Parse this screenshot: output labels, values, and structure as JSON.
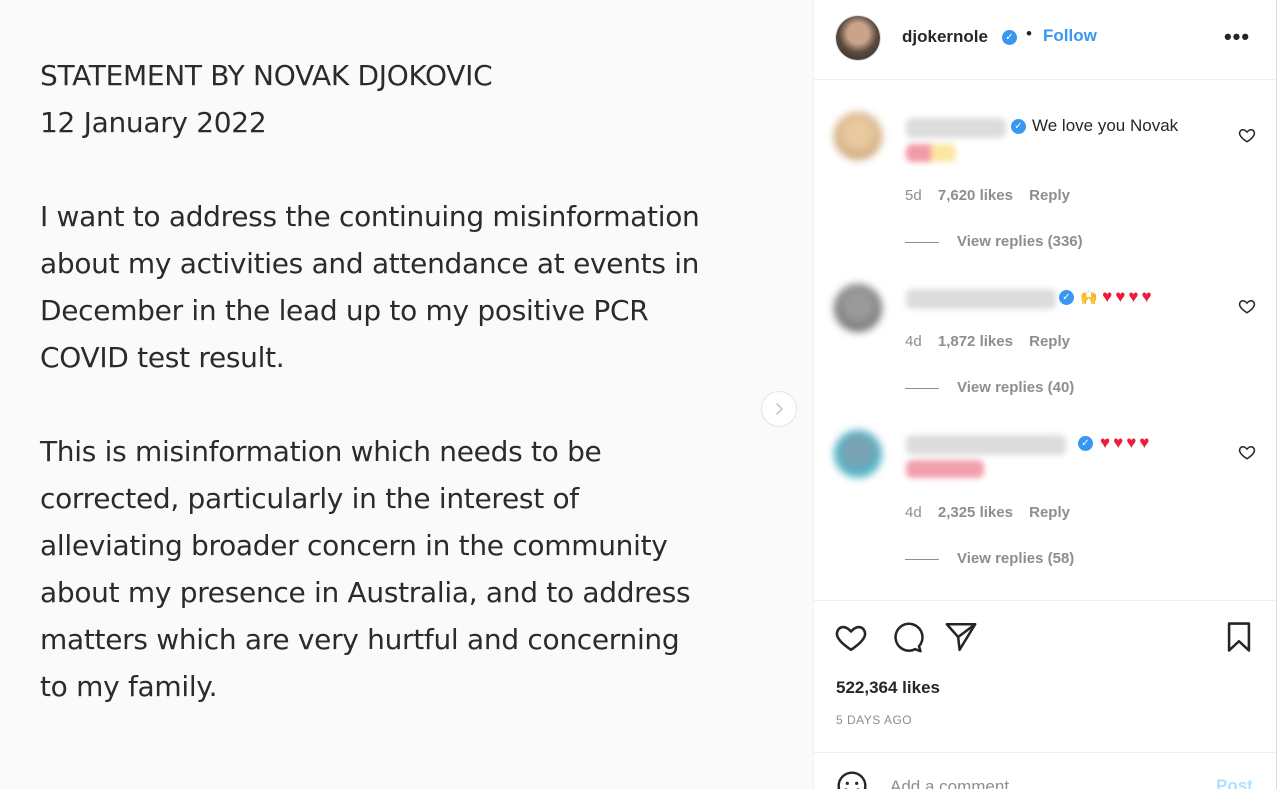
{
  "statement": {
    "title": "STATEMENT BY NOVAK DJOKOVIC",
    "date": "12 January 2022",
    "paragraph1": [
      "I want to address the continuing misinformation",
      "about my activities and attendance at events in",
      "December in the lead up to my positive PCR",
      "COVID test result."
    ],
    "paragraph2": [
      "This is misinformation which needs to be",
      "corrected, particularly in the interest of",
      "alleviating broader concern in the community",
      "about my presence in Australia, and to address",
      "matters which are very hurtful and concerning",
      "to my family."
    ]
  },
  "header": {
    "username": "djokernole",
    "separator": "•",
    "follow_label": "Follow",
    "more_label": "•••",
    "icons": {
      "verified": "verified-badge-icon",
      "more": "more-options-icon"
    }
  },
  "comments": [
    {
      "text": "We love you Novak",
      "age": "5d",
      "likes": "7,620 likes",
      "reply_label": "Reply",
      "view_replies": "View replies (336)"
    },
    {
      "text": "🙌 ♥♥♥♥",
      "age": "4d",
      "likes": "1,872 likes",
      "reply_label": "Reply",
      "view_replies": "View replies (40)"
    },
    {
      "text": "♥♥♥♥",
      "age": "4d",
      "likes": "2,325 likes",
      "reply_label": "Reply",
      "view_replies": "View replies (58)"
    }
  ],
  "actions": {
    "icons": [
      "heart-icon",
      "comment-icon",
      "share-icon",
      "bookmark-icon"
    ]
  },
  "post": {
    "likes": "522,364 likes",
    "time_ago": "5 DAYS AGO"
  },
  "add_comment": {
    "placeholder": "Add a comment...",
    "post_label": "Post"
  },
  "colors": {
    "accent": "#3897f0",
    "text": "#262626",
    "muted": "#8e8e8e",
    "heart": "#ed1c3a"
  }
}
